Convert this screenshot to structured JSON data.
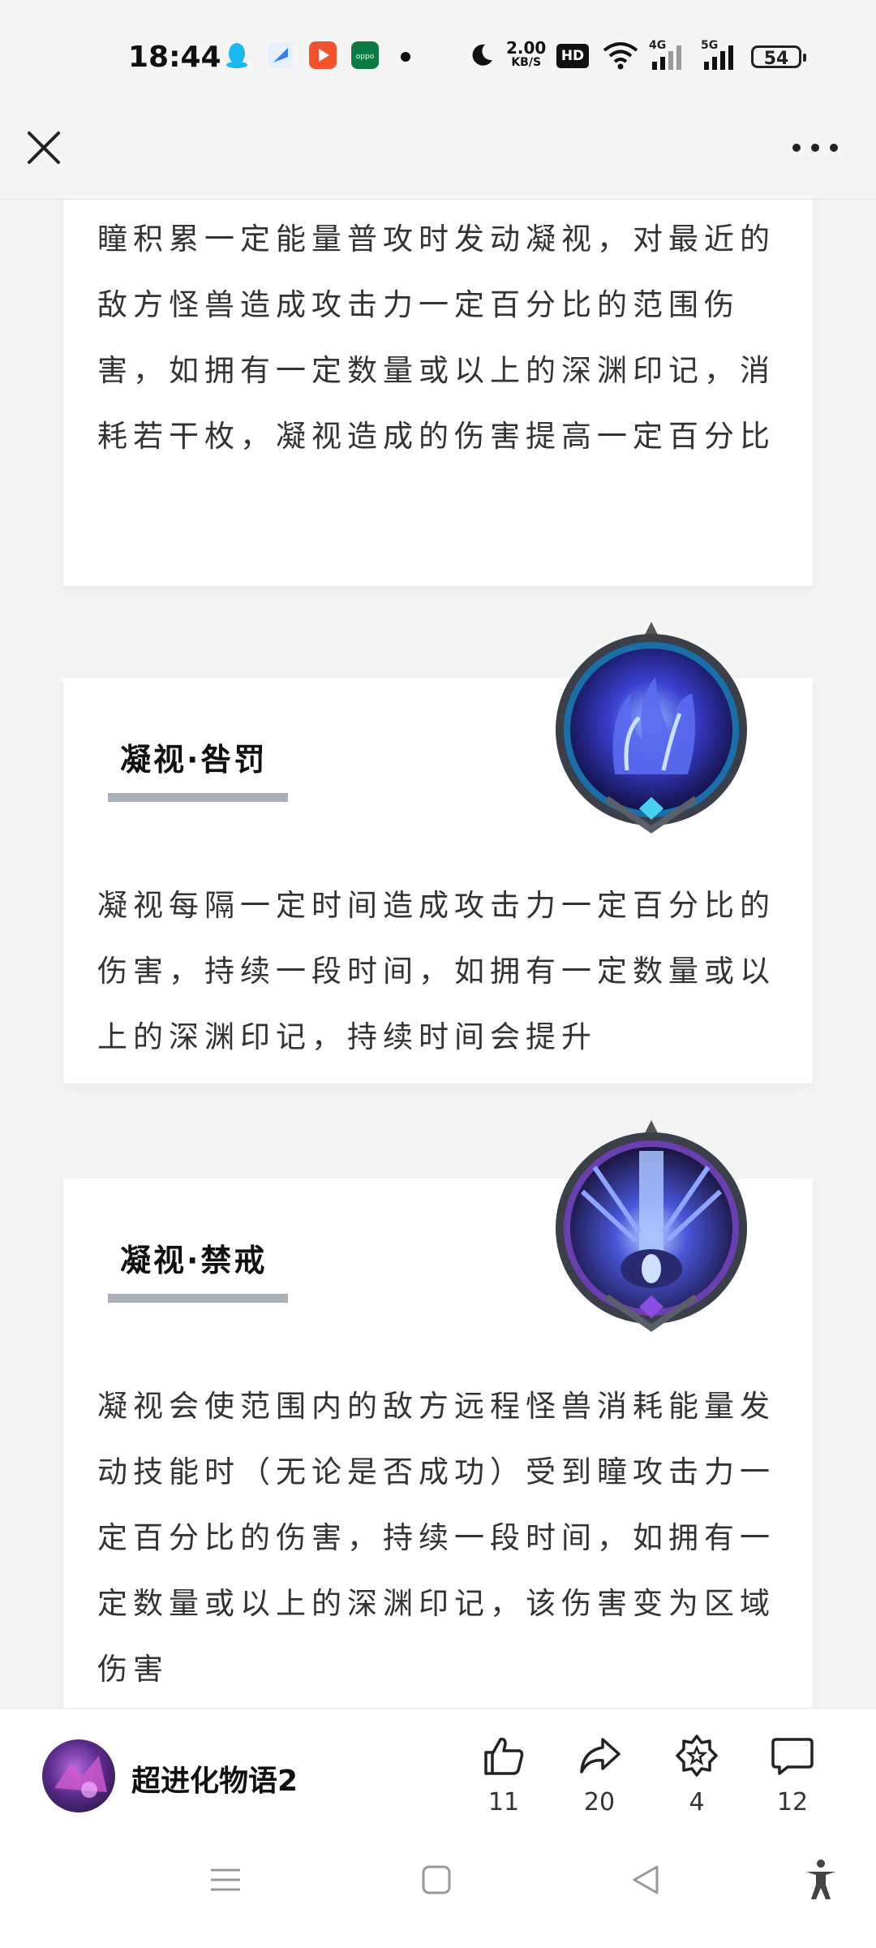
{
  "status_bar": {
    "time": "18:44",
    "speed_value": "2.00",
    "speed_unit": "KB/S",
    "hd_label": "HD",
    "net1": "4G",
    "net2": "5G",
    "battery": "54",
    "app_icons": [
      "qq-icon",
      "browser-icon",
      "video-app-icon",
      "oppo-icon"
    ],
    "colors": {
      "qq": "#19b8f0",
      "browser": "#2f7cf6",
      "video": "#f4522c",
      "oppo": "#0b7a43"
    }
  },
  "header": {
    "close_icon": "close-icon",
    "more_icon": "more-icon"
  },
  "cards": [
    {
      "text": "瞳积累一定能量普攻时发动凝视，对最近的敌方怪兽造成攻击力一定百分比的范围伤害，如拥有一定数量或以上的深渊印记，消耗若干枚，凝视造成的伤害提高一定百分比"
    },
    {
      "title": "凝视·咎罚",
      "badge_icon": "blue-flame-badge-icon",
      "text": "凝视每隔一定时间造成攻击力一定百分比的伤害，持续一段时间，如拥有一定数量或以上的深渊印记，持续时间会提升"
    },
    {
      "title": "凝视·禁戒",
      "badge_icon": "purple-eye-badge-icon",
      "text": "凝视会使范围内的敌方远程怪兽消耗能量发动技能时（无论是否成功）受到瞳攻击力一定百分比的伤害，持续一段时间，如拥有一定数量或以上的深渊印记，该伤害变为区域伤害"
    }
  ],
  "action_bar": {
    "channel_name": "超进化物语2",
    "like_count": "11",
    "share_count": "20",
    "collect_count": "4",
    "comment_count": "12"
  },
  "system_nav": [
    "menu-icon",
    "home-icon",
    "back-icon",
    "accessibility-icon"
  ]
}
